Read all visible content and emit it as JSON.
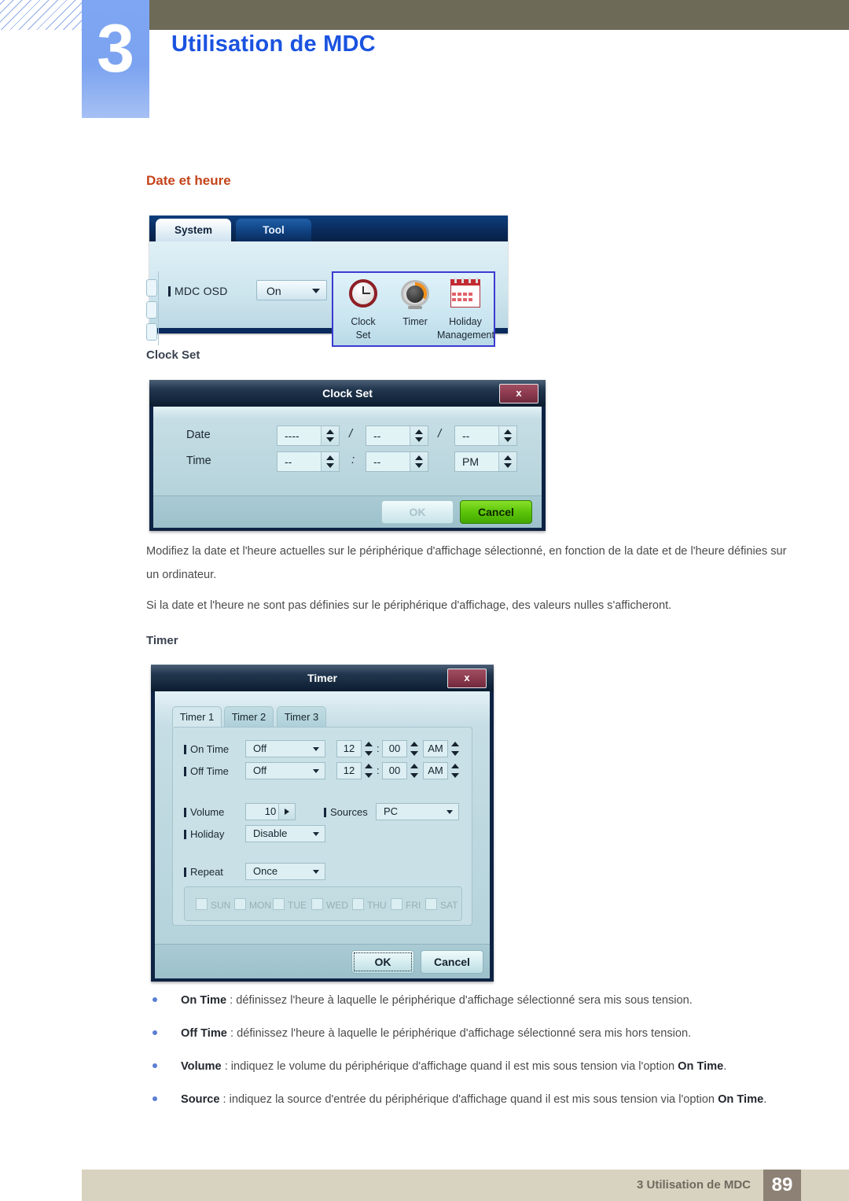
{
  "header": {
    "chapter_number": "3",
    "chapter_title": "Utilisation de MDC"
  },
  "sections": {
    "date_heure_heading": "Date et heure",
    "clock_set_heading": "Clock Set",
    "timer_heading": "Timer"
  },
  "osd_panel": {
    "tabs": [
      {
        "label": "System",
        "active": true
      },
      {
        "label": "Tool",
        "active": false
      }
    ],
    "mdc_osd_label": "MDC OSD",
    "mdc_osd_value": "On",
    "icons": [
      {
        "name": "clock-set-icon",
        "caption_line1": "Clock",
        "caption_line2": "Set"
      },
      {
        "name": "timer-icon",
        "caption_line1": "Timer",
        "caption_line2": ""
      },
      {
        "name": "holiday-management-icon",
        "caption_line1": "Holiday",
        "caption_line2": "Management"
      }
    ],
    "highlight_color": "#3b3bd1"
  },
  "clock_set_dialog": {
    "title": "Clock Set",
    "close_label": "x",
    "date_label": "Date",
    "time_label": "Time",
    "date_year": "----",
    "date_month": "--",
    "date_day": "--",
    "date_sep1": "/",
    "date_sep2": "/",
    "time_hour": "--",
    "time_minute": "--",
    "time_ampm": "PM",
    "time_sep": ":",
    "ok_label": "OK",
    "cancel_label": "Cancel"
  },
  "clock_set_paragraphs": [
    "Modifiez la date et l'heure actuelles sur le périphérique d'affichage sélectionné, en fonction de la date et de l'heure définies sur un ordinateur.",
    "Si la date et l'heure ne sont pas définies sur le périphérique d'affichage, des valeurs nulles s'afficheront."
  ],
  "timer_dialog": {
    "title": "Timer",
    "close_label": "x",
    "tabs": [
      {
        "label": "Timer 1",
        "active": true
      },
      {
        "label": "Timer 2",
        "active": false
      },
      {
        "label": "Timer 3",
        "active": false
      }
    ],
    "on_time": {
      "label": "On Time",
      "mode": "Off",
      "hour": "12",
      "minute": "00",
      "ampm": "AM",
      "separator": ":"
    },
    "off_time": {
      "label": "Off Time",
      "mode": "Off",
      "hour": "12",
      "minute": "00",
      "ampm": "AM",
      "separator": ":"
    },
    "volume": {
      "label": "Volume",
      "value": "10"
    },
    "sources": {
      "label": "Sources",
      "value": "PC"
    },
    "holiday": {
      "label": "Holiday",
      "value": "Disable"
    },
    "repeat": {
      "label": "Repeat",
      "value": "Once"
    },
    "days": [
      {
        "label": "SUN",
        "checked": false
      },
      {
        "label": "MON",
        "checked": false
      },
      {
        "label": "TUE",
        "checked": false
      },
      {
        "label": "WED",
        "checked": false
      },
      {
        "label": "THU",
        "checked": false
      },
      {
        "label": "FRI",
        "checked": false
      },
      {
        "label": "SAT",
        "checked": false
      }
    ],
    "ok_label": "OK",
    "cancel_label": "Cancel"
  },
  "timer_bullets": [
    {
      "term": "On Time",
      "rest": " : définissez l'heure à laquelle le périphérique d'affichage sélectionné sera mis sous tension."
    },
    {
      "term": "Off Time",
      "rest": " : définissez l'heure à laquelle le périphérique d'affichage sélectionné sera mis hors tension."
    },
    {
      "term": "Volume",
      "rest": " : indiquez le volume du périphérique d'affichage quand il est mis sous tension via l'option ",
      "term2": "On Time",
      "rest2": "."
    },
    {
      "term": "Source",
      "rest": " : indiquez la source d'entrée du périphérique d'affichage quand il est mis sous tension via l'option ",
      "term2": "On Time",
      "rest2": "."
    }
  ],
  "footer": {
    "text": "3 Utilisation de MDC",
    "page": "89"
  }
}
